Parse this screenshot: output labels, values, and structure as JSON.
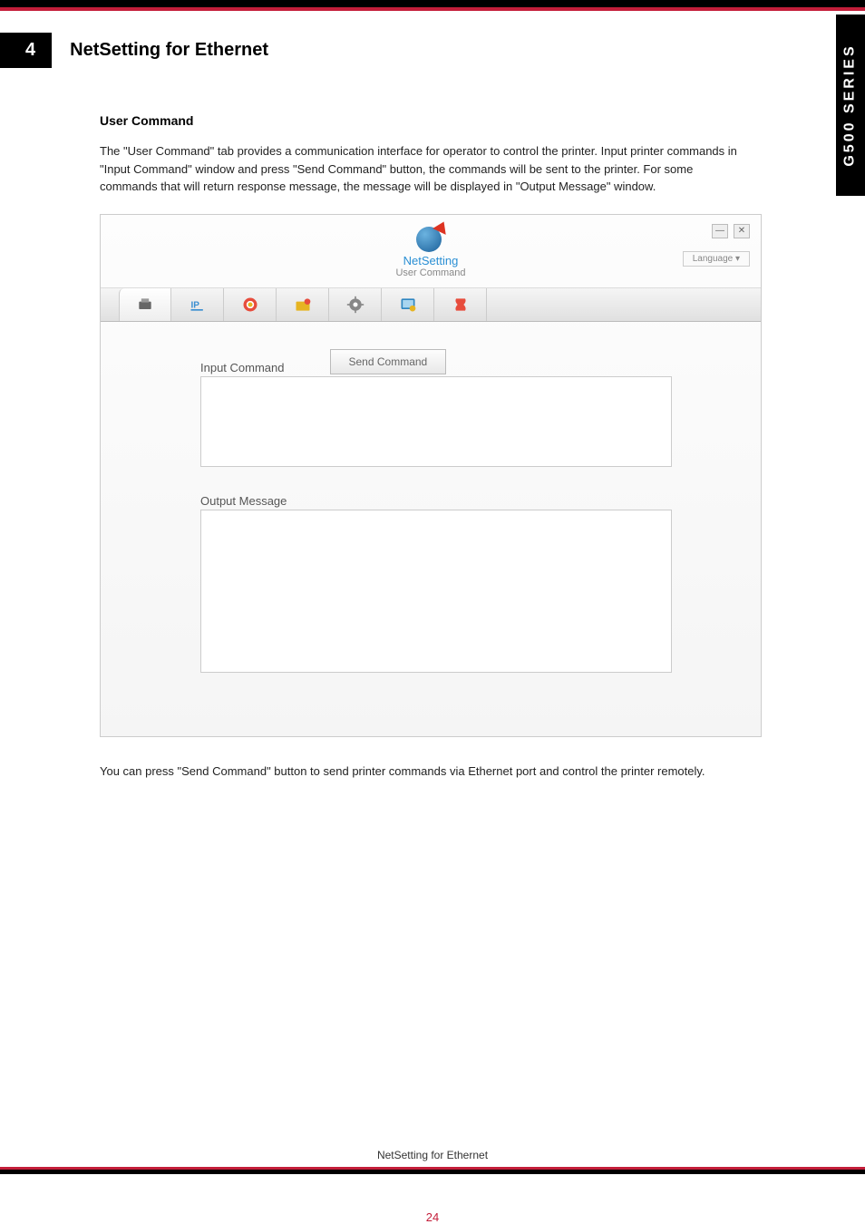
{
  "side_tab": "G500 SERIES",
  "header": {
    "number": "4",
    "title": "NetSetting for Ethernet"
  },
  "section": {
    "title": "User Command",
    "paragraph": "The \"User Command\" tab provides a communication interface for operator to control the printer. Input printer commands in \"Input Command\" window and press \"Send Command\" button, the commands will be sent to the printer. For some commands that will return response message, the message will be displayed in \"Output Message\" window."
  },
  "app": {
    "brand": "NetSetting",
    "subtitle": "User Command",
    "language_button": "Language  ▾",
    "tabs": [
      {
        "name": "printer-tab",
        "color": "#666"
      },
      {
        "name": "ip-tab",
        "color": "#3b8fd1"
      },
      {
        "name": "alert-tab",
        "color": "#e67e22"
      },
      {
        "name": "mail-tab",
        "color": "#e6b422"
      },
      {
        "name": "config-tab",
        "color": "#888"
      },
      {
        "name": "command-tab",
        "color": "#2e86c1"
      },
      {
        "name": "firmware-tab",
        "color": "#e74c3c"
      }
    ],
    "input_label": "Input Command",
    "send_button": "Send Command",
    "output_label": "Output Message"
  },
  "below_paragraph": "You can press \"Send Command\" button to send printer commands via Ethernet port and control the printer remotely.",
  "footer": {
    "label": "NetSetting for Ethernet",
    "page": "24"
  }
}
